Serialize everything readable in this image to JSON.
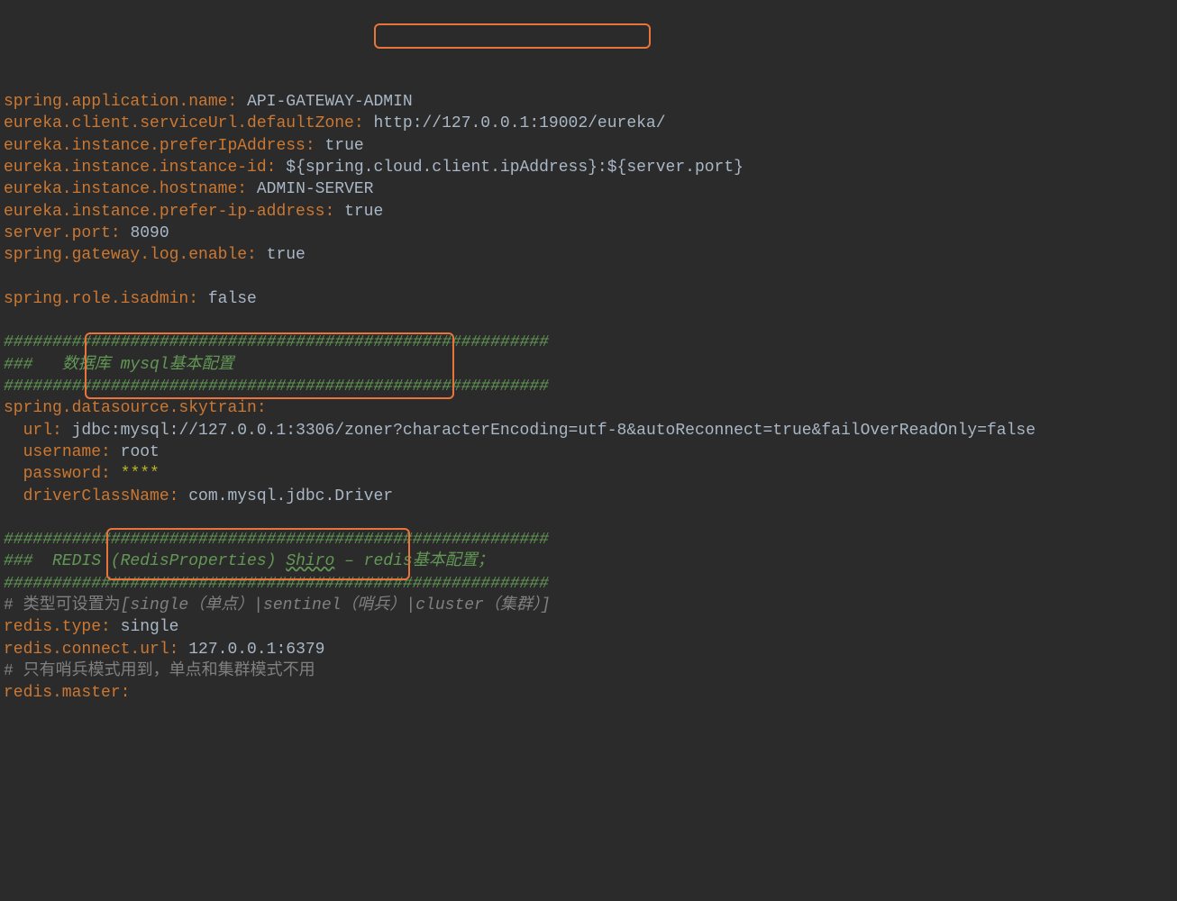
{
  "config": {
    "l1_key": "spring.application.name",
    "l1_val": "API-GATEWAY-ADMIN",
    "l2_key": "eureka.client.serviceUrl.defaultZone",
    "l2_val_a": "http://127.0.0.1:19002",
    "l2_val_b": "/eureka/",
    "l3_key": "eureka.instance.preferIpAddress",
    "l3_val": "true",
    "l4_key": "eureka.instance.instance-id",
    "l4_val": "${spring.cloud.client.ipAddress}:${server.port}",
    "l5_key": "eureka.instance.hostname",
    "l5_val": "ADMIN-SERVER",
    "l6_key": "eureka.instance.prefer-ip-address",
    "l6_val": "true",
    "l7_key": "server.port",
    "l7_val": "8090",
    "l8_key": "spring.gateway.log.enable",
    "l8_val": "true",
    "l9_key": "spring.role.isadmin",
    "l9_val": "false",
    "hash1": "########################################################",
    "hash2": "###   数据库 mysql基本配置",
    "hash3": "########################################################",
    "ds_key": "spring.datasource.skytrain",
    "ds_url_key": "url",
    "ds_url_a": "jdbc:mysql://127.0.0.1:3306/zoner",
    "ds_url_b": "?characterEncoding=utf-8&autoReconnect=true&failOverReadOnly=false",
    "ds_user_key": "username",
    "ds_user_val": "root",
    "ds_pass_key": "password",
    "ds_pass_val": "****",
    "ds_driver_key": "driverClassName",
    "ds_driver_val": "com.mysql.jdbc.Driver",
    "hash4": "########################################################",
    "hash5a": "###  REDIS (RedisProperties) ",
    "hash5b": "Shiro",
    "hash5c": " – redis基本配置；",
    "hash6": "########################################################",
    "redis_comment_a": "# 类型可设置为",
    "redis_comment_b": "[single（单点）|sentinel（哨兵）|cluster（集群）]",
    "redis_type_key": "redis.type",
    "redis_type_val": "single",
    "redis_url_key": "redis.connect.url",
    "redis_url_val": "127.0.0.1:6379",
    "redis_comment2": "# 只有哨兵模式用到，单点和集群模式不用",
    "redis_master_key": "redis.master"
  }
}
